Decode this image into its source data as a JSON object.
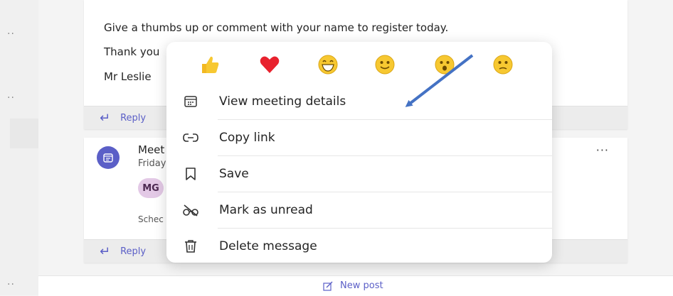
{
  "feed": {
    "top_post": {
      "line1": "Give a thumbs up or comment with your name to register today.",
      "line2": "Thank you",
      "line3": "Mr Leslie"
    },
    "meeting_post": {
      "title": "Meet",
      "subtitle": "Friday",
      "avatar_initials": "MG",
      "footer": "Schec",
      "more_label": "···"
    },
    "reply_label": "Reply",
    "new_post_label": "New post"
  },
  "rail": {
    "dots": "··"
  },
  "context_menu": {
    "reactions": [
      "thumbs-up",
      "heart",
      "laugh",
      "smile",
      "surprised",
      "sad"
    ],
    "items": [
      {
        "label": "View meeting details",
        "icon": "calendar-icon"
      },
      {
        "label": "Copy link",
        "icon": "link-icon"
      },
      {
        "label": "Save",
        "icon": "bookmark-icon"
      },
      {
        "label": "Mark as unread",
        "icon": "glasses-off-icon"
      },
      {
        "label": "Delete message",
        "icon": "trash-icon"
      }
    ]
  },
  "colors": {
    "accent": "#5b5fc7",
    "heart": "#e8222e",
    "emoji_yellow": "#f7c831",
    "annotation_arrow": "#4472c4"
  }
}
